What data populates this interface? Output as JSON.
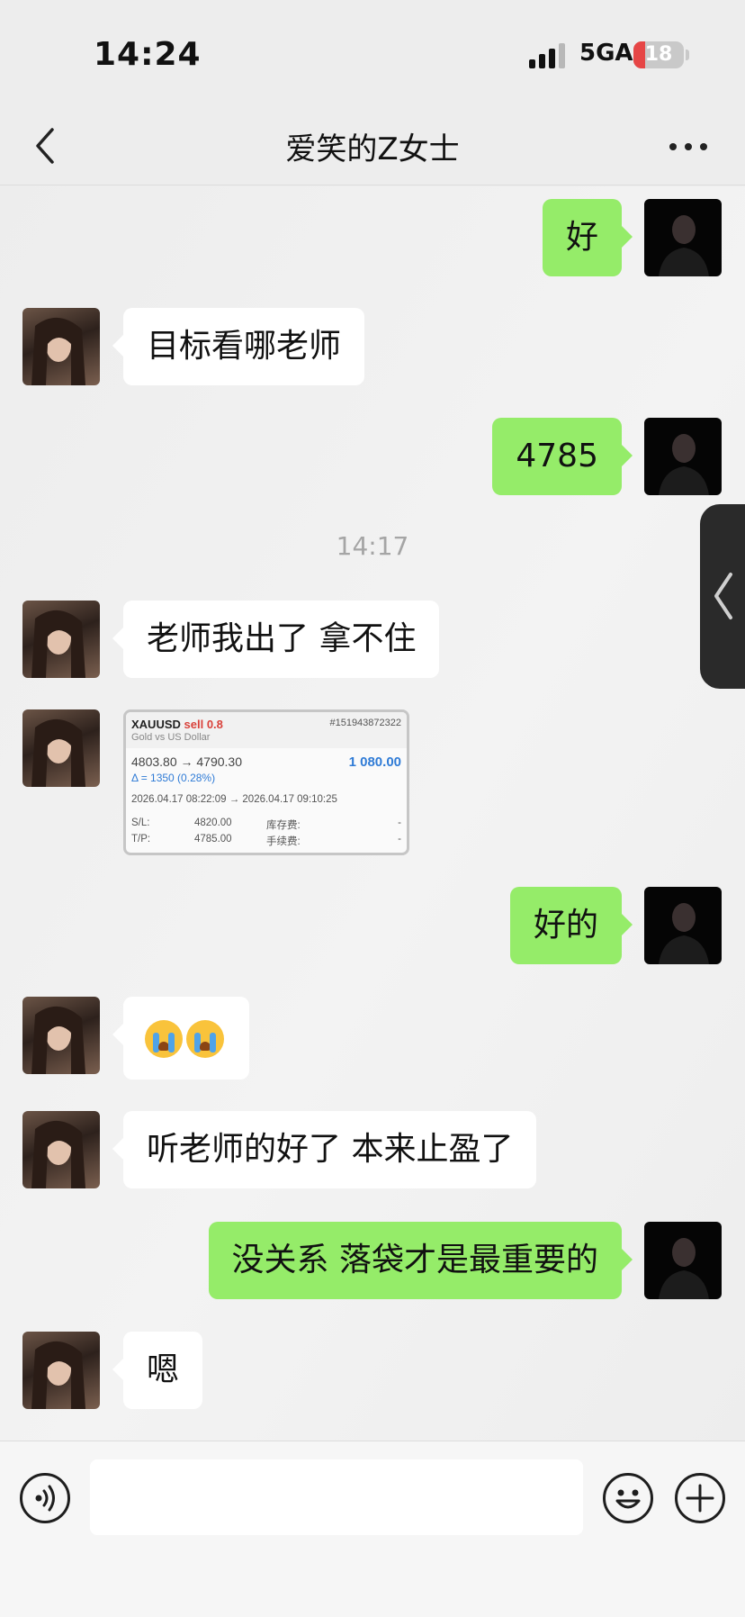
{
  "status_bar": {
    "time": "14:24",
    "network": "5GA",
    "battery": "18"
  },
  "nav": {
    "title": "爱笑的Z女士",
    "back_icon": "chevron-left-icon",
    "more_icon": "more-dots-icon"
  },
  "messages": [
    {
      "side": "me",
      "text": "好"
    },
    {
      "side": "her",
      "text": "目标看哪老师"
    },
    {
      "side": "me",
      "text": "4785"
    },
    {
      "side": "her",
      "text": "老师我出了 拿不住"
    },
    {
      "side": "me",
      "text": "好的"
    },
    {
      "side": "her",
      "text": "听老师的好了 本来止盈了"
    },
    {
      "side": "me",
      "text": "没关系 落袋才是最重要的"
    },
    {
      "side": "her",
      "text": "嗯"
    }
  ],
  "timestamp": "14:17",
  "emoji_message": {
    "emoji": "loudly-crying-face",
    "count": 2
  },
  "trade_card": {
    "symbol": "XAUUSD",
    "side": "sell 0.8",
    "order_id": "#151943872322",
    "description": "Gold vs US Dollar",
    "price": "4803.80 → 4790.30",
    "profit": "1 080.00",
    "delta": "Δ = 1350 (0.28%)",
    "dates": "2026.04.17 08:22:09 → 2026.04.17 09:10:25",
    "sl_label": "S/L:",
    "sl_value": "4820.00",
    "tp_label": "T/P:",
    "tp_value": "4785.00",
    "swap_label": "库存费:",
    "swap_value": "-",
    "fee_label": "手续费:",
    "fee_value": "-"
  },
  "input_bar": {
    "voice_icon": "voice-icon",
    "emoji_icon": "emoji-icon",
    "plus_icon": "plus-icon"
  },
  "colors": {
    "outgoing_bubble": "#95ec69",
    "incoming_bubble": "#ffffff",
    "background": "#ededed",
    "profit": "#2f7bd6",
    "sell": "#d9413a"
  }
}
